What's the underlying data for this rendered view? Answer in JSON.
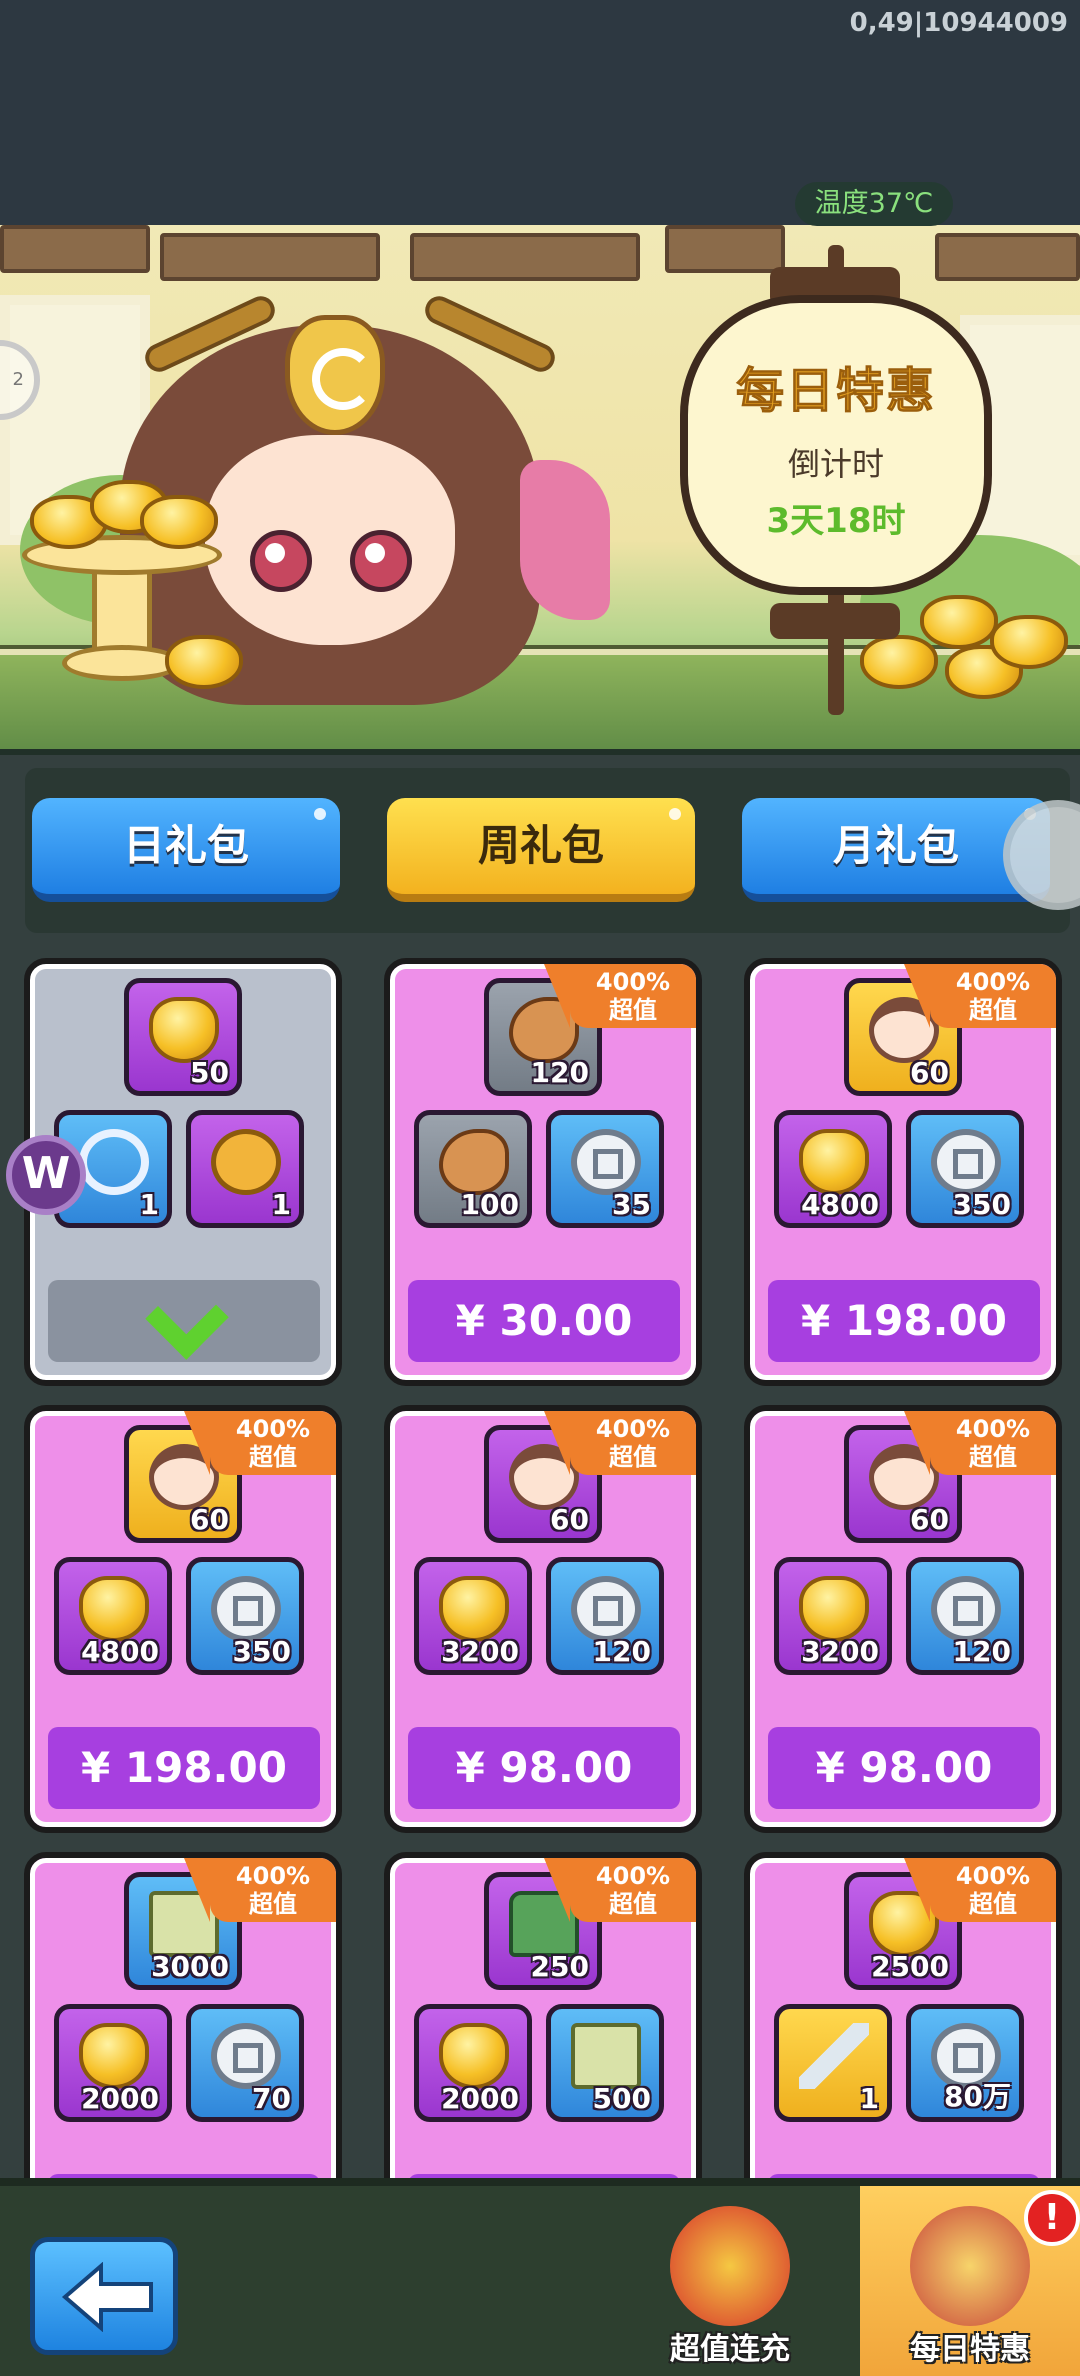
{
  "debug_id": "0,49|10944009",
  "temperature": "温度37℃",
  "banner": {
    "title": "每日特惠",
    "countdown_label": "倒计时",
    "countdown_value": "3天18时",
    "side_marker": "2"
  },
  "tabs": [
    {
      "label": "日礼包",
      "color": "blue"
    },
    {
      "label": "周礼包",
      "color": "yellow",
      "selected": true
    },
    {
      "label": "月礼包",
      "color": "blue"
    }
  ],
  "badge": {
    "line1": "400%",
    "line2": "超值"
  },
  "cards": [
    {
      "claimed": true,
      "badge": false,
      "top": {
        "icon": "gold-ingot-icon",
        "qty": "50",
        "bg": "purple"
      },
      "left": {
        "icon": "key-icon",
        "qty": "1",
        "bg": "blue"
      },
      "right": {
        "icon": "heart-coin-icon",
        "qty": "1",
        "bg": "purple"
      }
    },
    {
      "claimed": false,
      "badge": true,
      "price": "¥ 30.00",
      "top": {
        "icon": "meat-icon",
        "qty": "120",
        "bg": "gray"
      },
      "left": {
        "icon": "meat-icon",
        "qty": "100",
        "bg": "gray"
      },
      "right": {
        "icon": "silver-coin-icon",
        "qty": "35",
        "bg": "blue"
      }
    },
    {
      "claimed": false,
      "badge": true,
      "price": "¥ 198.00",
      "top": {
        "icon": "hero-portrait-icon",
        "qty": "60",
        "bg": "gold"
      },
      "left": {
        "icon": "gold-ingot-icon",
        "qty": "4800",
        "bg": "purple"
      },
      "right": {
        "icon": "silver-coin-icon",
        "qty": "350",
        "bg": "blue"
      }
    },
    {
      "claimed": false,
      "badge": true,
      "price": "¥ 198.00",
      "top": {
        "icon": "hero-portrait-icon",
        "qty": "60",
        "bg": "gold"
      },
      "left": {
        "icon": "gold-ingot-icon",
        "qty": "4800",
        "bg": "purple"
      },
      "right": {
        "icon": "silver-coin-icon",
        "qty": "350",
        "bg": "blue"
      }
    },
    {
      "claimed": false,
      "badge": true,
      "price": "¥ 98.00",
      "top": {
        "icon": "hero-portrait-icon",
        "qty": "60",
        "bg": "purple"
      },
      "left": {
        "icon": "gold-ingot-icon",
        "qty": "3200",
        "bg": "purple"
      },
      "right": {
        "icon": "silver-coin-icon",
        "qty": "120",
        "bg": "blue"
      }
    },
    {
      "claimed": false,
      "badge": true,
      "price": "¥ 98.00",
      "top": {
        "icon": "hero-portrait-icon",
        "qty": "60",
        "bg": "purple"
      },
      "left": {
        "icon": "gold-ingot-icon",
        "qty": "3200",
        "bg": "purple"
      },
      "right": {
        "icon": "silver-coin-icon",
        "qty": "120",
        "bg": "blue"
      }
    },
    {
      "claimed": false,
      "badge": true,
      "price": "",
      "top": {
        "icon": "map-scroll-icon",
        "qty": "3000",
        "bg": "blue"
      },
      "left": {
        "icon": "gold-ingot-icon",
        "qty": "2000",
        "bg": "purple"
      },
      "right": {
        "icon": "silver-coin-icon",
        "qty": "70",
        "bg": "blue"
      }
    },
    {
      "claimed": false,
      "badge": true,
      "price": "",
      "top": {
        "icon": "tank-icon",
        "qty": "250",
        "bg": "purple"
      },
      "left": {
        "icon": "gold-ingot-icon",
        "qty": "2000",
        "bg": "purple"
      },
      "right": {
        "icon": "map-scroll-icon",
        "qty": "500",
        "bg": "blue"
      }
    },
    {
      "claimed": false,
      "badge": true,
      "price": "",
      "top": {
        "icon": "gold-ingot-icon",
        "qty": "2500",
        "bg": "purple"
      },
      "left": {
        "icon": "sword-icon",
        "qty": "1",
        "bg": "gold"
      },
      "right": {
        "icon": "silver-coin-icon",
        "qty": "80万",
        "bg": "blue"
      }
    }
  ],
  "bottom_nav": {
    "back_icon": "back-arrow-icon",
    "items": [
      {
        "label": "超值连充",
        "active": false
      },
      {
        "label": "每日特惠",
        "active": true,
        "alert": "!"
      }
    ]
  },
  "side_widget_letter": "W"
}
